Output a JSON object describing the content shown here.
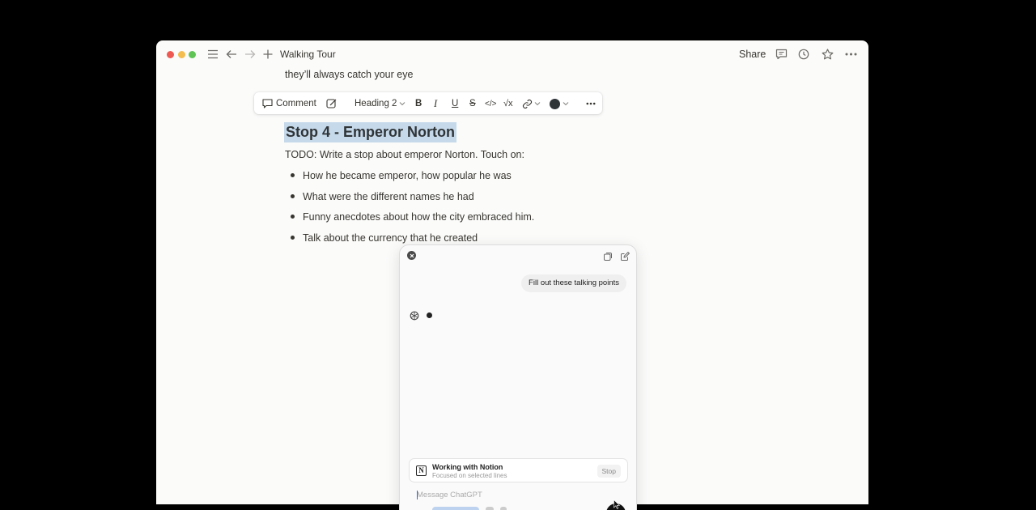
{
  "window": {
    "title": "Walking Tour",
    "share_label": "Share"
  },
  "document": {
    "previous_line": "they’ll always catch your eye",
    "heading": "Stop 4 - Emperor Norton",
    "todo": "TODO: Write a stop about emperor Norton. Touch on:",
    "bullets": [
      "How he became emperor, how popular he was",
      "What were the different names he had",
      "Funny anecdotes about how the city embraced him.",
      "Talk about the currency that he created"
    ]
  },
  "format_toolbar": {
    "comment_label": "Comment",
    "block_type": "Heading 2",
    "bold": "B",
    "italic": "I",
    "underline": "U",
    "strike": "S",
    "code": "</>",
    "equation": "√x",
    "text_color": "#2f3437"
  },
  "chat": {
    "user_message": "Fill out these talking points",
    "working_title": "Working with Notion",
    "working_subtitle": "Focused on selected lines",
    "stop_label": "Stop",
    "input_placeholder": "Message ChatGPT"
  }
}
